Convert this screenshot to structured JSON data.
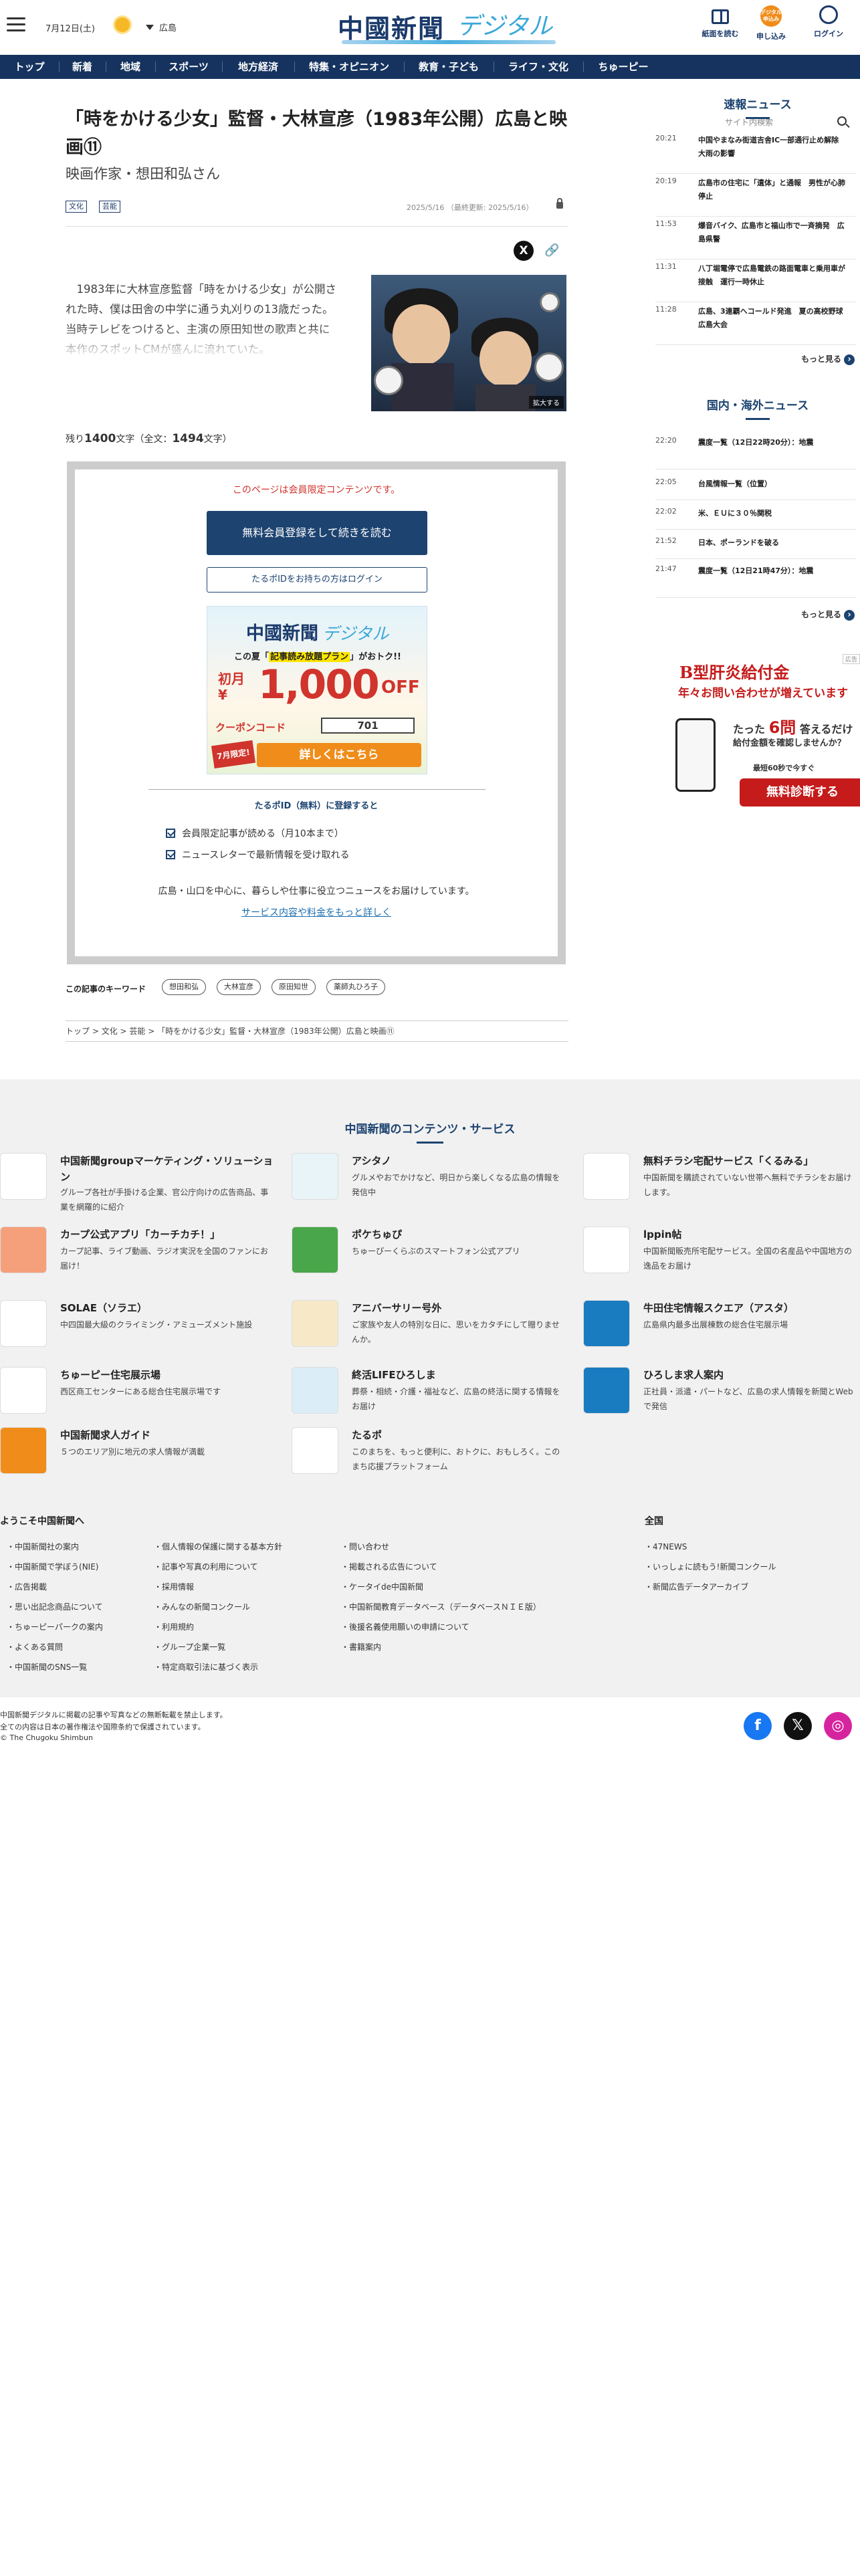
{
  "header": {
    "date": "7月12日(土)",
    "weather_icon": "sun-icon",
    "area": "広島",
    "logo_main": "中國新聞",
    "logo_sub": "デジタル",
    "icons": [
      {
        "label": "紙面を読む",
        "icon": "newspaper-icon"
      },
      {
        "label": "申し込み",
        "icon": "subscribe-icon",
        "badge": "デジタル申込み"
      },
      {
        "label": "ログイン",
        "icon": "login-icon"
      }
    ]
  },
  "nav": {
    "items": [
      "トップ",
      "新着",
      "地域",
      "スポーツ",
      "地方経済",
      "特集・オピニオン",
      "教育・子ども",
      "ライフ・文化",
      "ちゅーピー"
    ],
    "search_placeholder": "サイト内検索"
  },
  "article": {
    "title": "「時をかける少女」監督・大林宣彦（1983年公開）広島と映画⑪",
    "subtitle": "映画作家・想田和弘さん",
    "tags": [
      "文化",
      "芸能"
    ],
    "dates": "2025/5/16 （最終更新: 2025/5/16）",
    "lead": "1983年に大林宣彦監督「時をかける少女」が公開された時、僕は田舎の中学に通う丸刈りの13歳だった。当時テレビをつけると、主演の原田知世の歌声と共に本作のスポットCMが盛んに流れていた。",
    "photo_zoom": "拡大する",
    "count": {
      "prefix": "残り",
      "remaining": "1400",
      "mid": "文字（全文：",
      "total": "1494",
      "suffix": "文字）"
    }
  },
  "paywall": {
    "note": "このページは会員限定コンテンツです。",
    "register_button": "無料会員登録をして続きを読む",
    "login_button": "たるポIDをお持ちの方はログイン",
    "banner": {
      "logo_main": "中國新聞",
      "logo_sub": "デジタル",
      "line_pre": "この夏「",
      "line_em": "記事読み放題プラン",
      "line_post": "」がおトク!!",
      "first_month": "初月",
      "yen": "¥",
      "price": "1,000",
      "off": "OFF",
      "coupon_label": "クーポンコード",
      "coupon_code": "701",
      "limited": "7月限定!",
      "cta": "詳しくはこちら"
    },
    "id_title": "たるポID（無料）に登録すると",
    "benefits": [
      "会員限定記事が読める（月10本まで）",
      "ニュースレターで最新情報を受け取れる"
    ],
    "desc": "広島・山口を中心に、暮らしや仕事に役立つニュースをお届けしています。",
    "more_link": "サービス内容や料金をもっと詳しく"
  },
  "keywords": {
    "label": "この記事のキーワード",
    "items": [
      "想田和弘",
      "大林宣彦",
      "原田知世",
      "薬師丸ひろ子"
    ]
  },
  "breadcrumb": [
    "トップ",
    "文化",
    "芸能",
    "「時をかける少女」監督・大林宣彦（1983年公開）広島と映画⑪"
  ],
  "sidebar": {
    "breaking_title": "速報ニュース",
    "breaking": [
      {
        "time": "20:21",
        "text": "中国やまなみ街道吉舎IC一部通行止め解除　大雨の影響"
      },
      {
        "time": "20:19",
        "text": "広島市の住宅に「遺体」と通報　男性が心肺停止"
      },
      {
        "time": "11:53",
        "text": "爆音バイク、広島市と福山市で一斉摘発　広島県警"
      },
      {
        "time": "11:31",
        "text": "八丁堀電停で広島電鉄の路面電車と乗用車が接触　運行一時休止"
      },
      {
        "time": "11:28",
        "text": "広島、3連覇へコールド発進　夏の高校野球広島大会"
      }
    ],
    "more": "もっと見る",
    "national_title": "国内・海外ニュース",
    "national": [
      {
        "time": "22:20",
        "text": "震度一覧（12日22時20分）：地震"
      },
      {
        "time": "22:05",
        "text": "台風情報一覧（位置）"
      },
      {
        "time": "22:02",
        "text": "米、ＥＵに３０％関税"
      },
      {
        "time": "21:52",
        "text": "日本、ポーランドを破る"
      },
      {
        "time": "21:47",
        "text": "震度一覧（12日21時47分）：地震"
      }
    ],
    "ad": {
      "label": "広告",
      "t1": "B型肝炎給付金",
      "t2": "年々お問い合わせが増えています",
      "t3_pre": "たった",
      "t3_num": "6問",
      "t3_post": "答えるだけ",
      "t4": "給付金額を確認しませんか？",
      "t5": "最短60秒で今すぐ",
      "cta": "無料診断する"
    }
  },
  "footer": {
    "section_title": "中国新聞のコンテンツ・サービス",
    "services": [
      {
        "name": "中国新聞groupマーケティング・ソリューション",
        "desc": "グループ各社が手掛ける企業、官公庁向けの広告商品、事業を網羅的に紹介",
        "thumb": "#ffffff"
      },
      {
        "name": "アシタノ",
        "desc": "グルメやおでかけなど、明日から楽しくなる広島の情報を発信中",
        "thumb": "#e8f4f8"
      },
      {
        "name": "無料チラシ宅配サービス「くるみる」",
        "desc": "中国新聞を購読されていない世帯へ無料でチラシをお届けします。",
        "thumb": "#ffffff"
      },
      {
        "name": "カープ公式アプリ「カーチカチ！」",
        "desc": "カープ記事、ライブ動画、ラジオ実況を全国のファンにお届け！",
        "thumb": "#f5a07a"
      },
      {
        "name": "ポケちゅぴ",
        "desc": "ちゅーぴーくらぶのスマートフォン公式アプリ",
        "thumb": "#4aa64a"
      },
      {
        "name": "lppin帖",
        "desc": "中国新聞販売所宅配サービス。全国の名産品や中国地方の逸品をお届け",
        "thumb": "#ffffff"
      },
      {
        "name": "SOLAE（ソラエ）",
        "desc": "中四国最大級のクライミング・アミューズメント施設",
        "thumb": "#ffffff"
      },
      {
        "name": "アニバーサリー号外",
        "desc": "ご家族や友人の特別な日に、思いをカタチにして贈りませんか。",
        "thumb": "#f7e9c8"
      },
      {
        "name": "牛田住宅情報スクエア（アスタ）",
        "desc": "広島県内最多出展棟数の総合住宅展示場",
        "thumb": "#1a7cc0"
      },
      {
        "name": "ちゅーピー住宅展示場",
        "desc": "西区商工センターにある総合住宅展示場です",
        "thumb": "#ffffff"
      },
      {
        "name": "終活LIFEひろしま",
        "desc": "葬祭・相続・介護・福祉など、広島の終活に関する情報をお届け",
        "thumb": "#dbeef7"
      },
      {
        "name": "ひろしま求人案内",
        "desc": "正社員・派遣・パートなど、広島の求人情報を新聞とWebで発信",
        "thumb": "#1a7cc0"
      },
      {
        "name": "中国新聞求人ガイド",
        "desc": "５つのエリア別に地元の求人情報が満載",
        "thumb": "#f08c1a"
      },
      {
        "name": "たるポ",
        "desc": "このまちを、もっと便利に、おトクに、おもしろく。このまち応援プラットフォーム",
        "thumb": "#ffffff"
      }
    ],
    "welcome_title": "ようこそ中国新聞へ",
    "links_col1": [
      "中国新聞社の案内",
      "中国新聞で学ぼう(NIE)",
      "広告掲載",
      "思い出記念商品について",
      "ちゅーピーパークの案内",
      "よくある質問",
      "中国新聞のSNS一覧"
    ],
    "links_col2": [
      "個人情報の保護に関する基本方針",
      "記事や写真の利用について",
      "採用情報",
      "みんなの新聞コンクール",
      "利用規約",
      "グループ企業一覧",
      "特定商取引法に基づく表示"
    ],
    "links_col3": [
      "問い合わせ",
      "掲載される広告について",
      "ケータイde中国新聞",
      "中国新聞教育データベース（データベースＮＩＥ版）",
      "後援名義使用願いの申請について",
      "書籍案内"
    ],
    "national_title": "全国",
    "national_links": [
      "47NEWS",
      "いっしょに読もう!新聞コンクール",
      "新聞広告データアーカイブ"
    ],
    "copy1": "中国新聞デジタルに掲載の記事や写真などの無断転載を禁止します。",
    "copy2": "全ての内容は日本の著作権法や国際条約で保護されています。",
    "copy3": "© The Chugoku Shimbun",
    "social": [
      {
        "icon": "facebook-icon",
        "glyph": "f",
        "color": "#1877f2"
      },
      {
        "icon": "x-icon",
        "glyph": "𝕏",
        "color": "#111111"
      },
      {
        "icon": "instagram-icon",
        "glyph": "◎",
        "color": "#d6249f"
      }
    ]
  }
}
